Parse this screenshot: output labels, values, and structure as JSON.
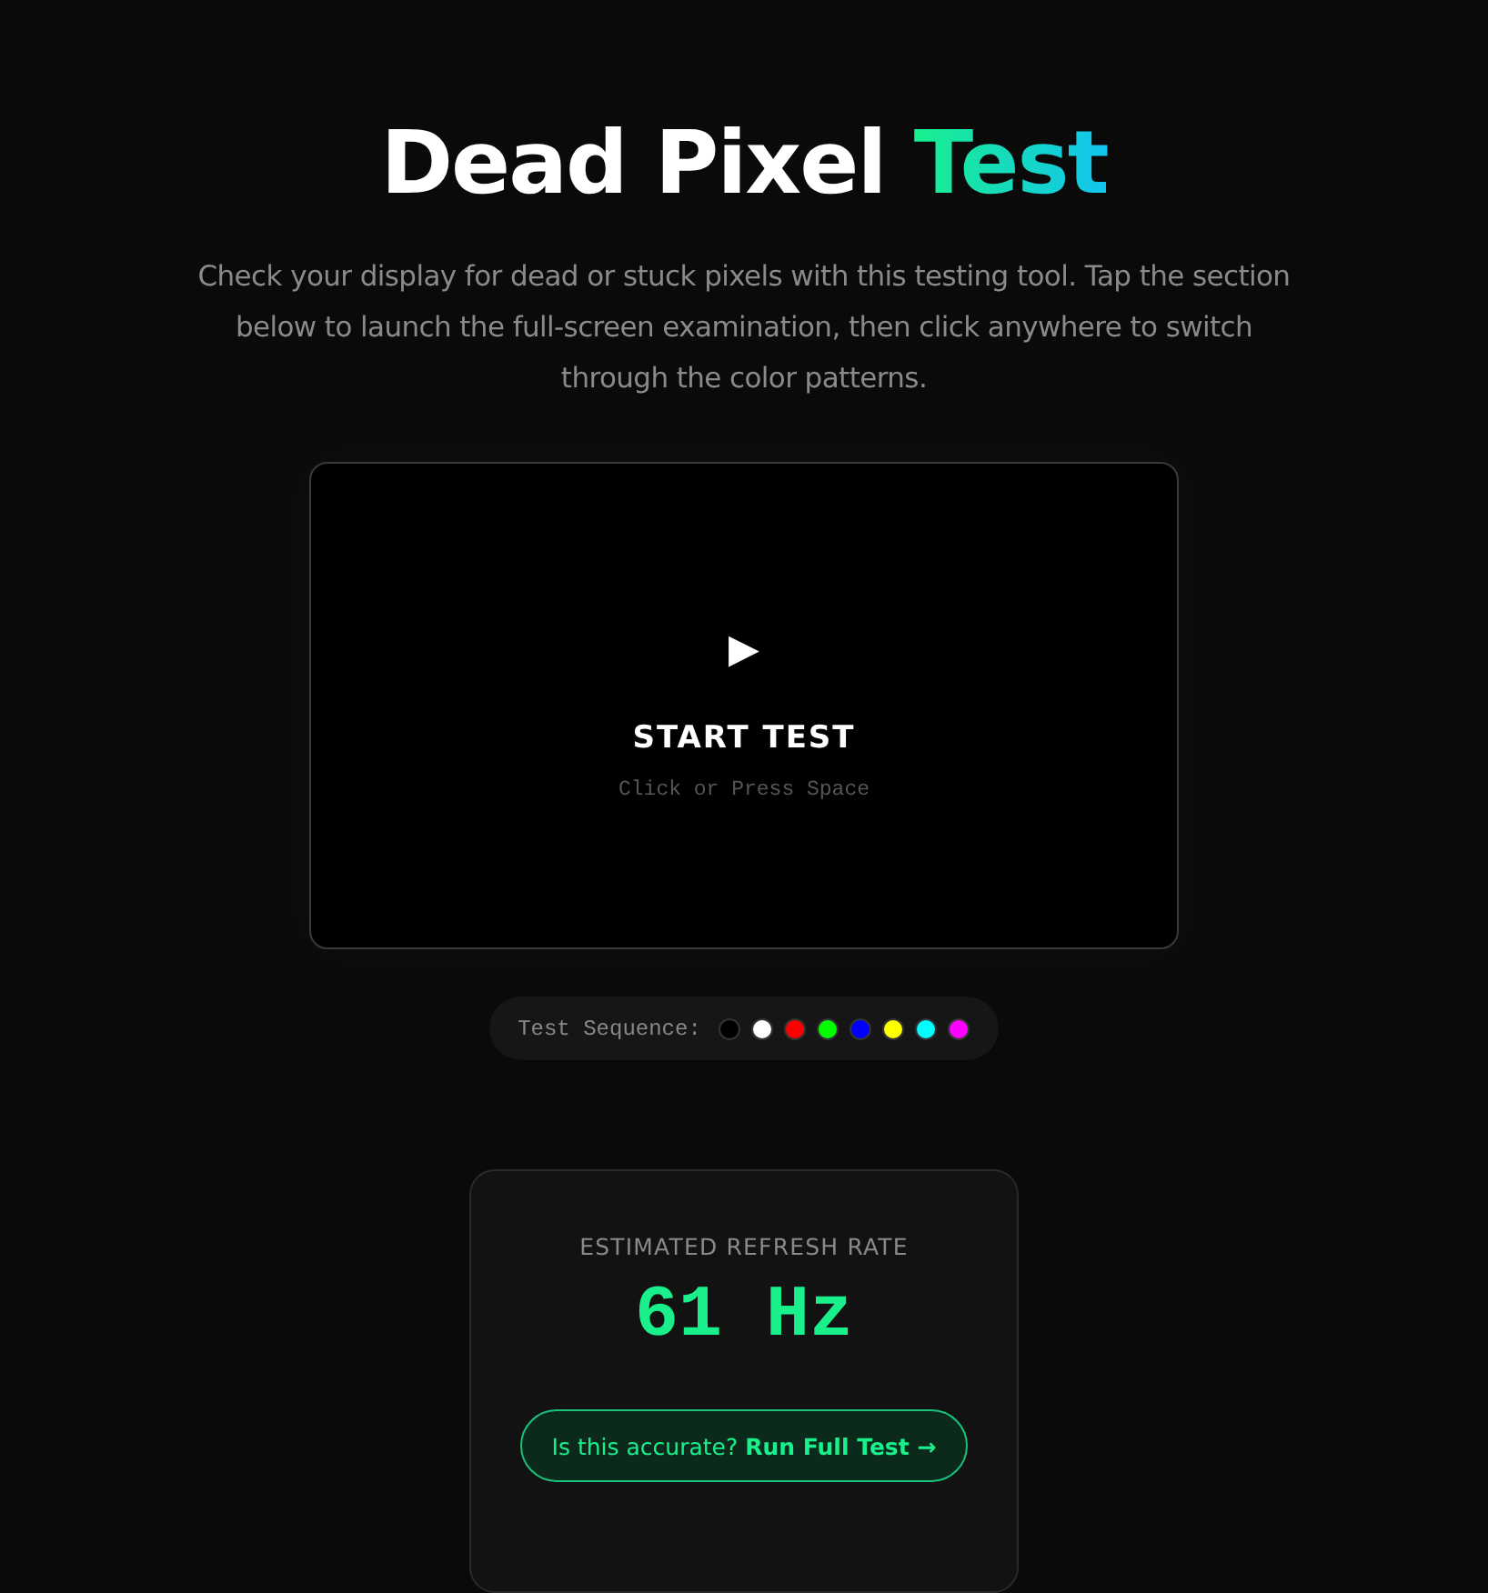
{
  "title": {
    "text": "Dead Pixel",
    "highlight": "Test"
  },
  "description": "Check your display for dead or stuck pixels with this testing tool. Tap the section below to launch the full-screen examination, then click anywhere to switch through the color patterns.",
  "test_area": {
    "icon": "▶",
    "label": "START TEST",
    "hint": "Click or Press Space"
  },
  "sequence": {
    "label": "Test Sequence:",
    "colors": [
      {
        "color": "#000000"
      },
      {
        "color": "#ffffff"
      },
      {
        "color": "#ff0000"
      },
      {
        "color": "#00ff00"
      },
      {
        "color": "#0000ff"
      },
      {
        "color": "#ffff00"
      },
      {
        "color": "#00ffff"
      },
      {
        "color": "#ff00ff"
      }
    ]
  },
  "refresh_card": {
    "label": "ESTIMATED REFRESH RATE",
    "value": "61 Hz",
    "button": "Is this accurate? **Run Full Test →**"
  }
}
